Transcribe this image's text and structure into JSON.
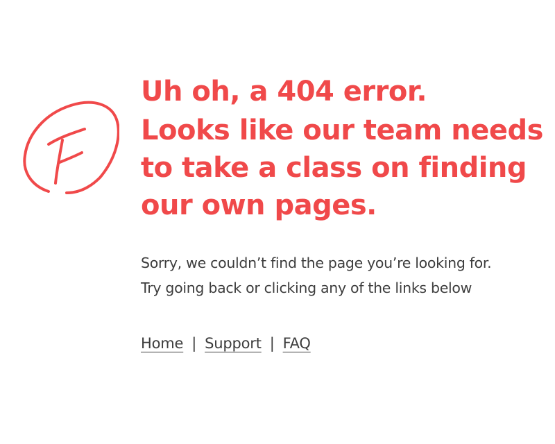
{
  "error_page": {
    "icon": "f-grade-circle-icon",
    "accent_color": "#f0494a",
    "headline_line1": "Uh oh, a 404 error.",
    "headline_line2": "Looks like our team needs to take a class on finding our own pages.",
    "message_line1": "Sorry, we couldn’t find the page you’re looking for.",
    "message_line2": "Try going back or clicking any of the links below"
  },
  "links": {
    "home": "Home",
    "support": "Support",
    "faq": "FAQ",
    "separator": "|"
  }
}
